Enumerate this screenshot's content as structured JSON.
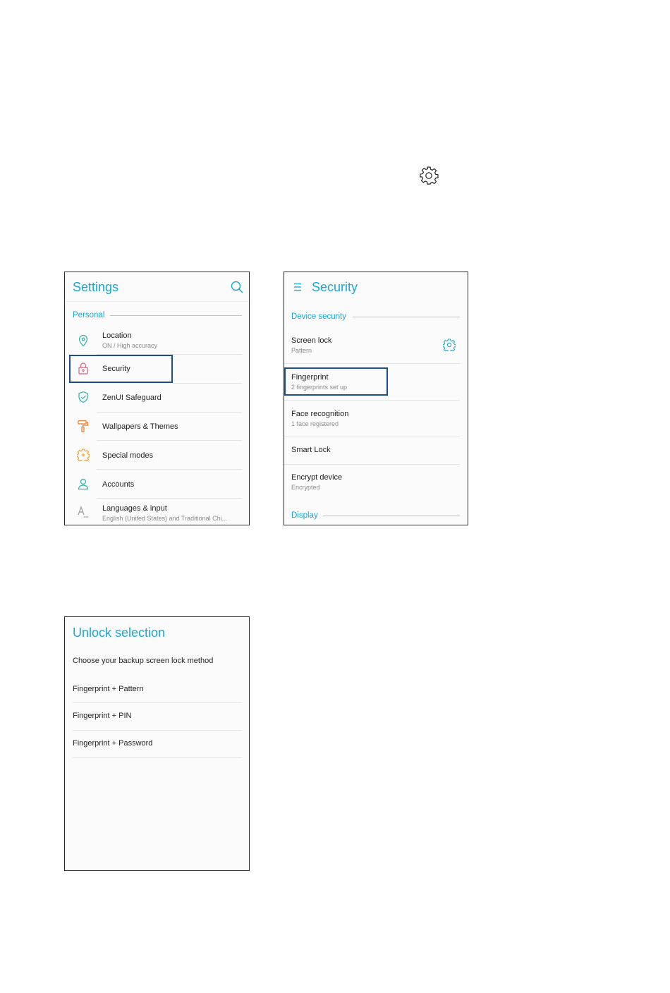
{
  "top_icon": "gear-icon",
  "settings": {
    "title": "Settings",
    "section": "Personal",
    "items": [
      {
        "label": "Location",
        "sub": "ON / High accuracy",
        "icon": "location-pin-icon",
        "color": "#2bb3a6"
      },
      {
        "label": "Security",
        "icon": "lock-icon",
        "color": "#e05a7a"
      },
      {
        "label": "ZenUI Safeguard",
        "icon": "shield-check-icon",
        "color": "#2bb3a6"
      },
      {
        "label": "Wallpapers & Themes",
        "icon": "paint-roller-icon",
        "color": "#f07a2a"
      },
      {
        "label": "Special modes",
        "icon": "gear-plus-icon",
        "color": "#f39a1f"
      },
      {
        "label": "Accounts",
        "icon": "person-icon",
        "color": "#2bb3a6"
      },
      {
        "label": "Languages & input",
        "sub": "English (United States) and Traditional Chi...",
        "icon": "language-icon",
        "color": "#9a9a9a"
      }
    ]
  },
  "security": {
    "title": "Security",
    "section": "Device security",
    "items": [
      {
        "label": "Screen lock",
        "sub": "Pattern"
      },
      {
        "label": "Fingerprint",
        "sub": "2 fingerprints set up"
      },
      {
        "label": "Face recognition",
        "sub": "1 face registered"
      },
      {
        "label": "Smart Lock"
      },
      {
        "label": "Encrypt device",
        "sub": "Encrypted"
      }
    ],
    "section2": "Display"
  },
  "unlock": {
    "title": "Unlock selection",
    "prompt": "Choose your backup screen lock method",
    "options": [
      "Fingerprint + Pattern",
      "Fingerprint + PIN",
      "Fingerprint + Password"
    ]
  },
  "colors": {
    "accent": "#19a8d3",
    "highlight": "#1f4e8c"
  }
}
